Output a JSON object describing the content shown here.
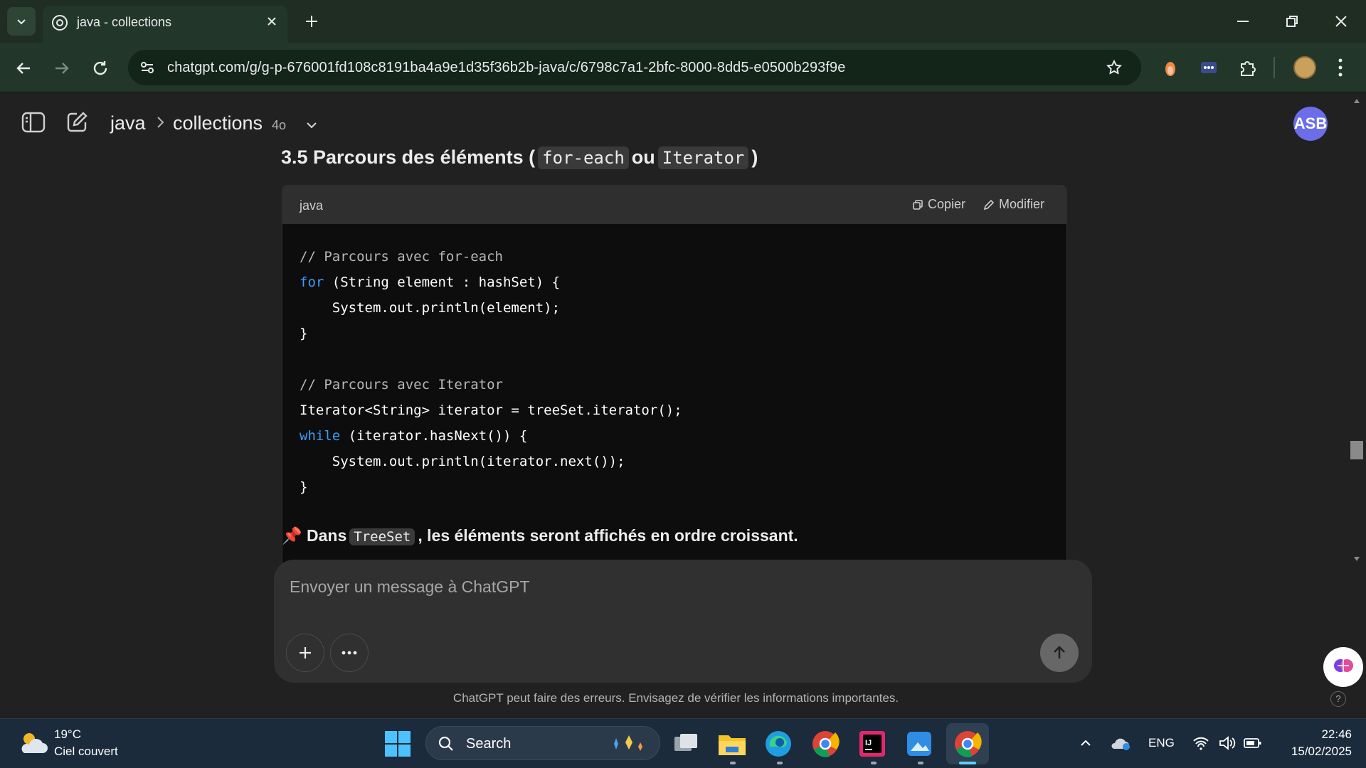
{
  "browser": {
    "tab_title": "java - collections",
    "url": "chatgpt.com/g/g-p-676001fd108c8191ba4a9e1d35f36b2b-java/c/6798c7a1-2bfc-8000-8dd5-e0500b293f9e"
  },
  "header": {
    "project": "java",
    "chat_title": "collections",
    "model_badge": "4o",
    "avatar_initials": "ASB"
  },
  "content": {
    "heading_prefix": "3.5 Parcours des éléments (",
    "heading_code1": "for-each",
    "heading_or": "ou",
    "heading_code2": "Iterator",
    "heading_suffix": ")",
    "code": {
      "language": "java",
      "copy_label": "Copier",
      "edit_label": "Modifier",
      "lines": [
        "// Parcours avec for-each",
        "for (String element : hashSet) {",
        "    System.out.println(element);",
        "}",
        "",
        "// Parcours avec Iterator",
        "Iterator<String> iterator = treeSet.iterator();",
        "while (iterator.hasNext()) {",
        "    System.out.println(iterator.next());",
        "}"
      ]
    },
    "note_prefix": "Dans",
    "note_code": "TreeSet",
    "note_suffix": ", les éléments seront affichés en ordre croissant."
  },
  "composer": {
    "placeholder": "Envoyer un message à ChatGPT"
  },
  "disclaimer": "ChatGPT peut faire des erreurs. Envisagez de vérifier les informations importantes.",
  "taskbar": {
    "weather_temp": "19°C",
    "weather_desc": "Ciel couvert",
    "search_label": "Search",
    "language": "ENG",
    "time": "22:46",
    "date": "15/02/2025"
  },
  "colors": {
    "page_bg": "#212121",
    "code_bg": "#0d0d0d",
    "keyword": "#3a9bf8",
    "avatar": "#6b6ee8",
    "browser_frame": "#22372a",
    "taskbar": "#1b2b3c"
  }
}
